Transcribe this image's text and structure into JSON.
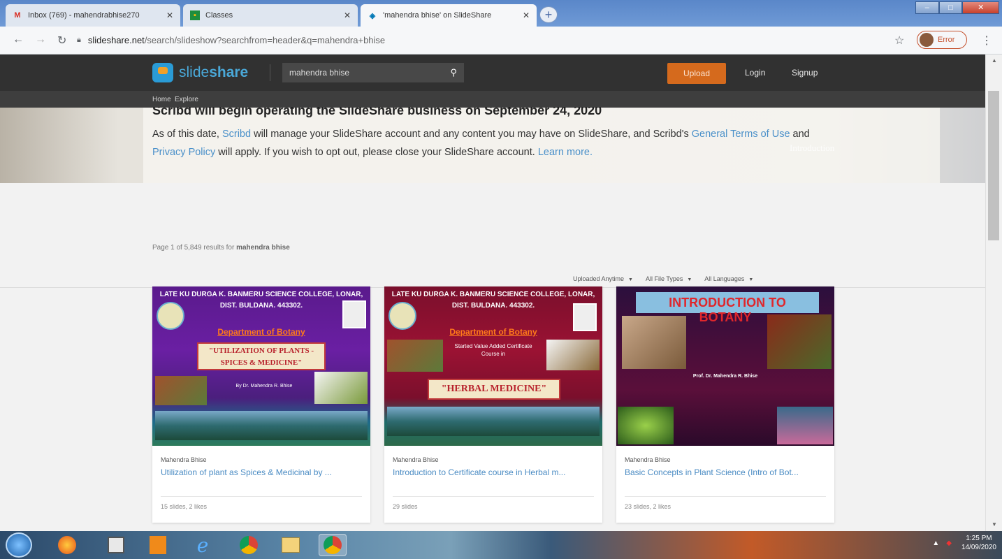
{
  "browser": {
    "tabs": [
      {
        "label": "Inbox (769) - mahendrabhise270",
        "icon": "gmail-icon",
        "active": false
      },
      {
        "label": "Classes",
        "icon": "classroom-icon",
        "active": false
      },
      {
        "label": "'mahendra bhise' on SlideShare",
        "icon": "slideshare-icon",
        "active": true
      }
    ],
    "new_tab": "+",
    "url_host": "slideshare.net",
    "url_path": "/search/slideshow?searchfrom=header&q=mahendra+bhise",
    "profile_label": "Error"
  },
  "header": {
    "logo_part1": "slide",
    "logo_part2": "share",
    "search_value": "mahendra bhise",
    "upload_label": "Upload",
    "login_label": "Login",
    "signup_label": "Signup",
    "subnav": [
      "Home",
      "Explore"
    ]
  },
  "notice": {
    "title": "Scribd will begin operating the SlideShare business on September 24, 2020",
    "text_1": "As of this date, ",
    "scribd_link": "Scribd",
    "text_2": " will manage your SlideShare account and any content you may have on SlideShare, and Scribd's ",
    "terms_link": "General Terms of Use",
    "text_3": " and ",
    "privacy_link": "Privacy Policy",
    "text_4": " will apply. If you wish to opt out, please close your SlideShare account. ",
    "learn_link": "Learn more.",
    "side_text": "Introduction"
  },
  "results": {
    "count_prefix": "Page 1 of 5,849 results for ",
    "query": "mahendra bhise",
    "filters": [
      "Uploaded Anytime",
      "All File Types",
      "All Languages"
    ]
  },
  "cards": [
    {
      "author": "Mahendra Bhise",
      "title": "Utilization of plant as Spices & Medicinal by ...",
      "meta": "15 slides, 2 likes",
      "thumb_heading": "LATE KU DURGA K. BANMERU SCIENCE COLLEGE, LONAR, DIST. BULDANA. 443302.",
      "thumb_dept": "Department of Botany",
      "thumb_box": "\"UTILIZATION OF PLANTS - SPICES & MEDICINE\"",
      "thumb_by": "By Dr. Mahendra R. Bhise"
    },
    {
      "author": "Mahendra Bhise",
      "title": "Introduction to Certificate course in Herbal m...",
      "meta": "29 slides",
      "thumb_heading": "LATE KU DURGA K. BANMERU SCIENCE COLLEGE, LONAR, DIST. BULDANA. 443302.",
      "thumb_dept": "Department of Botany",
      "thumb_started": "Started Value Added Certificate Course in",
      "thumb_box": "\"HERBAL MEDICINE\""
    },
    {
      "author": "Mahendra Bhise",
      "title": "Basic Concepts in Plant Science (Intro of Bot...",
      "meta": "23 slides, 2 likes",
      "thumb_line1": "INTRODUCTION TO",
      "thumb_line2": "BOTANY",
      "thumb_by": "Prof. Dr. Mahendra R. Bhise"
    }
  ],
  "taskbar": {
    "time": "1:25 PM",
    "date": "14/09/2020"
  }
}
